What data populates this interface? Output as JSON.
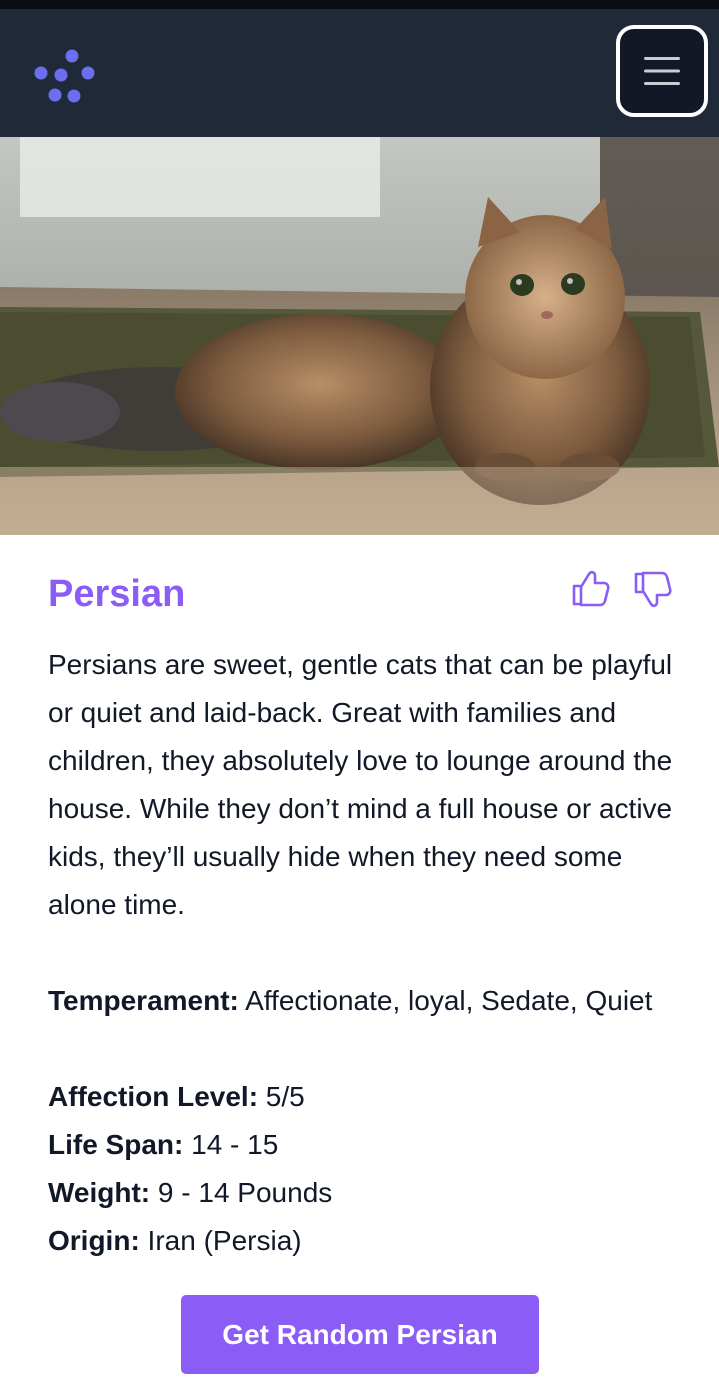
{
  "navbar": {
    "logo_icon": "logo-dots-icon",
    "menu_icon": "hamburger-menu-icon"
  },
  "hero": {
    "image": "persian-cat-photo"
  },
  "breed": {
    "name": "Persian",
    "description": "Persians are sweet, gentle cats that can be playful or quiet and laid-back. Great with families and children, they absolutely love to lounge around the house. While they don’t mind a full house or active kids, they’ll usually hide when they need some alone time.",
    "temperament_label": "Temperament:",
    "temperament_value": " Affectionate, loyal, Sedate, Quiet",
    "affection_label": "Affection Level:",
    "affection_value": " 5/5",
    "lifespan_label": "Life Span:",
    "lifespan_value": " 14 - 15",
    "weight_label": "Weight:",
    "weight_value": " 9 - 14 Pounds",
    "origin_label": "Origin:",
    "origin_value": " Iran (Persia)"
  },
  "actions": {
    "like_icon": "thumbs-up-icon",
    "dislike_icon": "thumbs-down-icon",
    "random_button_label": "Get Random Persian"
  },
  "colors": {
    "accent": "#8b5cf6",
    "navbar_bg": "#1f2937",
    "text": "#111827"
  }
}
